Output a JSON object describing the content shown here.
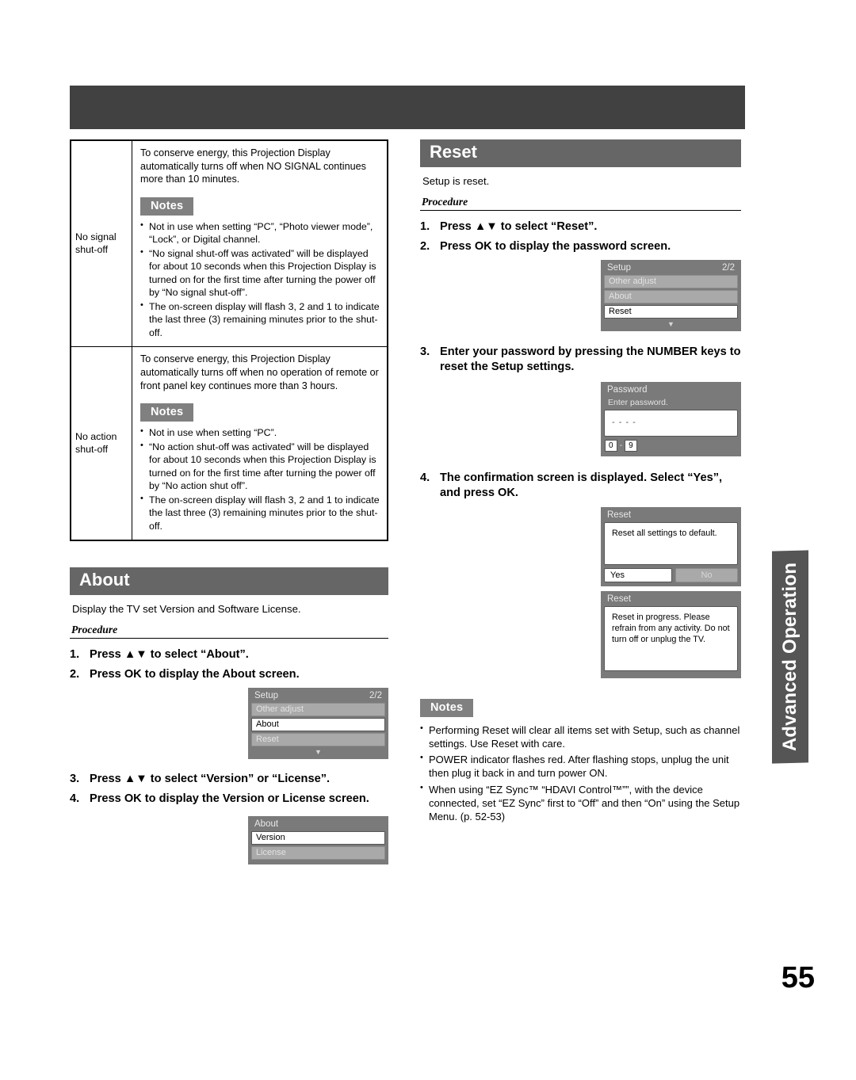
{
  "page": {
    "number": "55",
    "side_tab": "Advanced Operation"
  },
  "shutoff_table": {
    "rows": [
      {
        "label": "No signal\nshut-off",
        "intro": "To conserve energy, this Projection Display automatically turns off when NO SIGNAL continues more than 10 minutes.",
        "notes_badge": "Notes",
        "notes": [
          "Not in use when setting “PC”, “Photo viewer mode”, “Lock”, or Digital channel.",
          "“No signal shut-off was activated” will be displayed for about 10 seconds when this Projection Display is turned on for the first time after turning the power off by “No signal shut-off”.",
          "The on-screen display will flash 3, 2 and 1 to indicate the last three (3) remaining minutes prior to the shut-off."
        ]
      },
      {
        "label": "No action\nshut-off",
        "intro": "To conserve energy, this Projection Display automatically turns off when no operation of remote or front panel key continues more than 3 hours.",
        "notes_badge": "Notes",
        "notes": [
          "Not in use when setting “PC”.",
          "“No action shut-off was activated” will be displayed for about 10 seconds when this Projection Display is turned on for the first time after turning the power off by “No action shut off”.",
          "The on-screen display will flash 3, 2 and 1 to indicate the last three (3) remaining minutes prior to the shut-off."
        ]
      }
    ]
  },
  "about_section": {
    "title": "About",
    "description": "Display the TV set Version and Software License.",
    "procedure_label": "Procedure",
    "steps": [
      {
        "num": "1.",
        "text": "Press ▲▼ to select “About”."
      },
      {
        "num": "2.",
        "text": "Press OK to display the About screen."
      },
      {
        "num": "3.",
        "text": "Press ▲▼ to select “Version” or “License”."
      },
      {
        "num": "4.",
        "text": "Press OK to display the Version or License screen."
      }
    ],
    "setup_osd": {
      "title": "Setup",
      "page_indicator": "2/2",
      "items": [
        {
          "label": "Other adjust",
          "selected": false
        },
        {
          "label": "About",
          "selected": true
        },
        {
          "label": "Reset",
          "selected": false
        }
      ],
      "caret": "▼"
    },
    "about_osd": {
      "title": "About",
      "items": [
        {
          "label": "Version",
          "selected": true
        },
        {
          "label": "License",
          "selected": false
        }
      ]
    }
  },
  "reset_section": {
    "title": "Reset",
    "description": "Setup is reset.",
    "procedure_label": "Procedure",
    "steps_group1": [
      {
        "num": "1.",
        "text": "Press ▲▼ to select “Reset”."
      },
      {
        "num": "2.",
        "text": "Press OK to display the password screen."
      }
    ],
    "setup_osd": {
      "title": "Setup",
      "page_indicator": "2/2",
      "items": [
        {
          "label": "Other adjust",
          "selected": false
        },
        {
          "label": "About",
          "selected": false
        },
        {
          "label": "Reset",
          "selected": true
        }
      ],
      "caret": "▼"
    },
    "step3": {
      "num": "3.",
      "text": "Enter your password by pressing the NUMBER keys to reset the Setup settings."
    },
    "password_osd": {
      "title": "Password",
      "prompt": "Enter password.",
      "field_value": "- - - -",
      "key_min": "0",
      "key_sep": "-",
      "key_max": "9"
    },
    "step4": {
      "num": "4.",
      "text": "The confirmation screen is displayed. Select “Yes”, and press OK."
    },
    "confirm_osd": {
      "title": "Reset",
      "message": "Reset all settings to default.",
      "yes_label": "Yes",
      "no_label": "No"
    },
    "progress_osd": {
      "title": "Reset",
      "message": "Reset in progress. Please refrain from any activity. Do not turn off or unplug the TV."
    },
    "notes_badge": "Notes",
    "notes": [
      "Performing Reset will clear all items set with Setup, such as channel settings. Use Reset with care.",
      "POWER indicator flashes red. After flashing stops, unplug the unit then plug it back in and turn power ON.",
      "When using “EZ Sync™ “HDAVI Control™””, with the device connected, set “EZ Sync” first to “Off” and then “On” using the Setup Menu. (p. 52-53)"
    ]
  },
  "colors": {
    "header_band": "#414141",
    "section_bar": "#666666",
    "notes_badge": "#808080",
    "side_tab": "#555555",
    "osd_bg": "#7a7a7a",
    "osd_row": "#a9a9a9"
  }
}
